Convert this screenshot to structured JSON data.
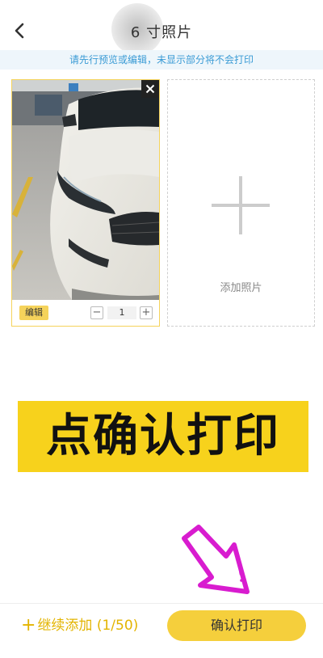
{
  "header": {
    "title": "6 寸照片",
    "back_icon": "chevron-left-icon"
  },
  "notice": {
    "text": "请先行预览或编辑，未显示部分将不会打印"
  },
  "photo_card": {
    "edit_label": "编辑",
    "quantity": "1",
    "minus_label": "−",
    "plus_label": "+",
    "remove_icon": "close-icon"
  },
  "add_card": {
    "label": "添加照片",
    "icon": "plus-icon"
  },
  "banner": {
    "text": "点确认打印"
  },
  "bottom_bar": {
    "continue_add_plus": "+",
    "continue_add_label": "继续添加 (1/50)",
    "confirm_label": "确认打印"
  },
  "colors": {
    "accent_yellow": "#f5cf3c",
    "notice_text": "#3a9bd5",
    "banner_bg": "#f7d21c",
    "annotation_magenta": "#d81ccf"
  }
}
